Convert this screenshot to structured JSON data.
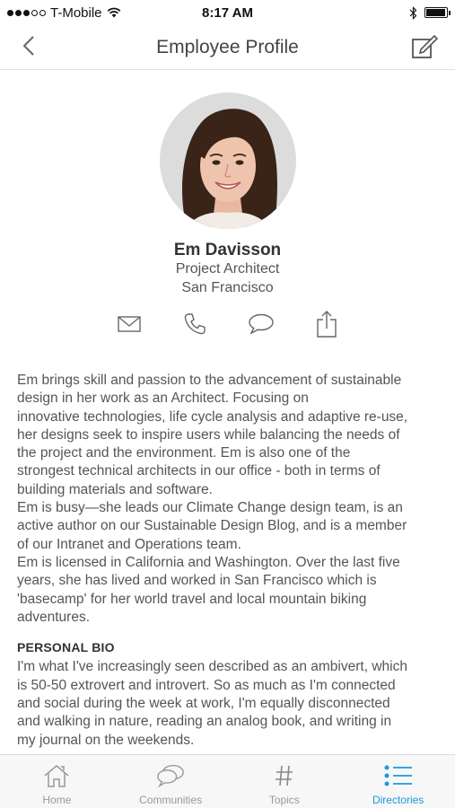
{
  "status_bar": {
    "carrier": "T-Mobile",
    "time": "8:17 AM",
    "signal_bars_filled": 3,
    "signal_bars_total": 5,
    "battery_level": 0.95
  },
  "nav": {
    "title": "Employee Profile",
    "back_icon": "chevron-left-icon",
    "edit_icon": "edit-icon"
  },
  "profile": {
    "name": "Em Davisson",
    "title": "Project Architect",
    "location": "San Francisco"
  },
  "actions": [
    {
      "icon": "mail-icon"
    },
    {
      "icon": "phone-icon"
    },
    {
      "icon": "chat-icon"
    },
    {
      "icon": "share-icon"
    }
  ],
  "bio": {
    "paragraph_1": "Em brings skill and passion to the advancement of sustainable\ndesign in her work as an Architect. Focusing on\ninnovative technologies, life cycle analysis and adaptive re-use,\nher designs seek to inspire users while balancing the needs of\nthe project and the environment. Em is also one of the\nstrongest technical architects in our office - both in terms of\nbuilding materials and software.",
    "paragraph_2": "Em is busy—she leads our Climate Change design team, is an\nactive author on our Sustainable Design Blog, and is a member\nof our Intranet and Operations team.",
    "paragraph_3": "Em is licensed in California and Washington. Over the last five\nyears, she has lived and worked in San Francisco which is\n'basecamp' for her world travel and local mountain biking\nadventures."
  },
  "personal_bio": {
    "heading": "PERSONAL BIO",
    "text": "I'm what I've increasingly seen described as an ambivert, which\nis 50-50 extrovert and introvert. So as much as I'm connected\nand social during the week at work, I'm equally disconnected\nand walking in nature, reading an analog book, and writing in\nmy journal on the weekends."
  },
  "tabs": [
    {
      "label": "Home",
      "icon": "home-icon",
      "active": false
    },
    {
      "label": "Communities",
      "icon": "communities-icon",
      "active": false
    },
    {
      "label": "Topics",
      "icon": "hashtag-icon",
      "active": false
    },
    {
      "label": "Directories",
      "icon": "list-icon",
      "active": true
    }
  ],
  "colors": {
    "accent": "#1a9ad6",
    "text": "#555555",
    "tab_inactive": "#999999"
  }
}
